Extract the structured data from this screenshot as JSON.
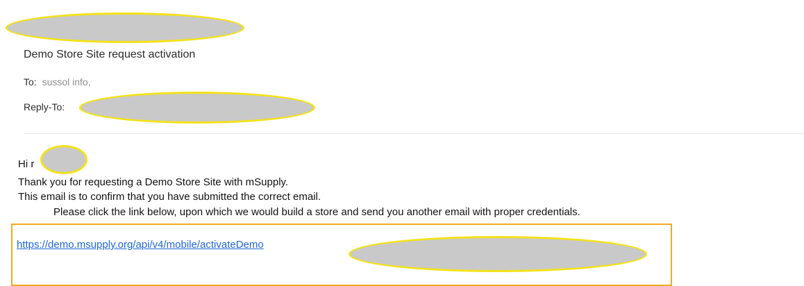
{
  "email": {
    "subject": "Demo Store Site request activation",
    "to_label": "To:",
    "to_value": "sussol info,",
    "reply_to_label": "Reply-To:",
    "greeting": "Hi r",
    "greeting_suffix": ",",
    "body_lines": [
      "Thank you for requesting a Demo Store Site with mSupply.",
      "This email is to confirm that you have submitted the correct email.",
      "Please click the link below,  upon which we would build a store and send you another email with proper credentials."
    ],
    "activation_link": "https://demo.msupply.org/api/v4/mobile/activateDemo"
  },
  "colors": {
    "redaction_fill": "#c9c9c9",
    "redaction_outline": "#f3e21a",
    "link_box_border": "#f4a81f",
    "link": "#2066d6"
  }
}
